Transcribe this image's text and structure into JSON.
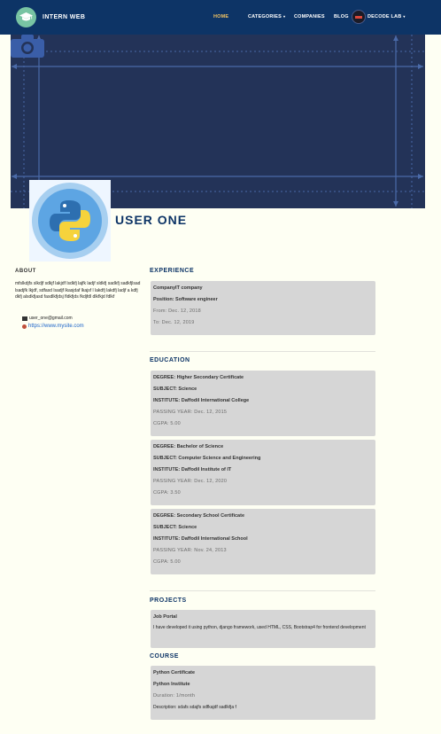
{
  "navbar": {
    "brand": "INTERN WEB",
    "links": [
      {
        "label": "HOME",
        "active": true
      },
      {
        "label": "CATEGORIES",
        "dropdown": true
      },
      {
        "label": "COMPANIES"
      },
      {
        "label": "BLOG"
      },
      {
        "label": "DECODE LAB",
        "dropdown": true
      }
    ],
    "active_color": "#f3c462",
    "background": "#0d3466"
  },
  "profile": {
    "name": "USER ONE",
    "avatar_icon": "python-logo-icon",
    "cover_icon": "camera-icon"
  },
  "about": {
    "heading": "ABOUT",
    "text": "mfslkdjfs slkdjf sdkjf lakjdf lsdkfj lajfk ladjf sldkfj sadkfj sadkfjlsad lsadjfk lkjdf, sdfasd lsadjf lkasjdaf lkajsf l lakdfj lakdfj ladjf a kdfj dkfj alsdkfjasd fasdlkfjdsj fldkfjds fkdjfdl dlkfkjd fdlkf",
    "email": "user_one@gmail.com",
    "website": "https://www.mysite.com"
  },
  "experience": {
    "heading": "EXPERIENCE",
    "items": [
      {
        "company": "CompanyIT company",
        "position": "Position: Software engineer",
        "from": "From: Dec. 12, 2018",
        "to": "To: Dec. 12, 2019"
      }
    ]
  },
  "education": {
    "heading": "EDUCATION",
    "items": [
      {
        "degree": "DEGREE: Higher Secondary Certificate",
        "subject": "SUBJECT: Science",
        "institute": "INSTITUTE: Daffodil International College",
        "passing_year": "PASSING YEAR: Dec. 12, 2015",
        "cgpa": "CGPA: 5.00"
      },
      {
        "degree": "DEGREE: Bachelor of Science",
        "subject": "SUBJECT: Computer Science and Engineering",
        "institute": "INSTITUTE: Daffodil Institute of IT",
        "passing_year": "PASSING YEAR: Dec. 12, 2020",
        "cgpa": "CGPA: 3.50"
      },
      {
        "degree": "DEGREE: Secondary School Certificate",
        "subject": "SUBJECT: Science",
        "institute": "INSTITUTE: Daffodil International School",
        "passing_year": "PASSING YEAR: Nov. 24, 2013",
        "cgpa": "CGPA: 5.00"
      }
    ]
  },
  "projects": {
    "heading": "PROJECTS",
    "items": [
      {
        "title": "Job Portal",
        "description": "I have developed it using python, django framework, used HTML, CSS, Bootstrap4 for frontend development"
      }
    ]
  },
  "course": {
    "heading": "COURSE",
    "items": [
      {
        "title": "Python Certificate",
        "institute": "Python Institute",
        "duration": "Duration: 1/month",
        "description": "Description: sdafs sdajfs sdfkajdf sadlkfja f"
      }
    ]
  }
}
